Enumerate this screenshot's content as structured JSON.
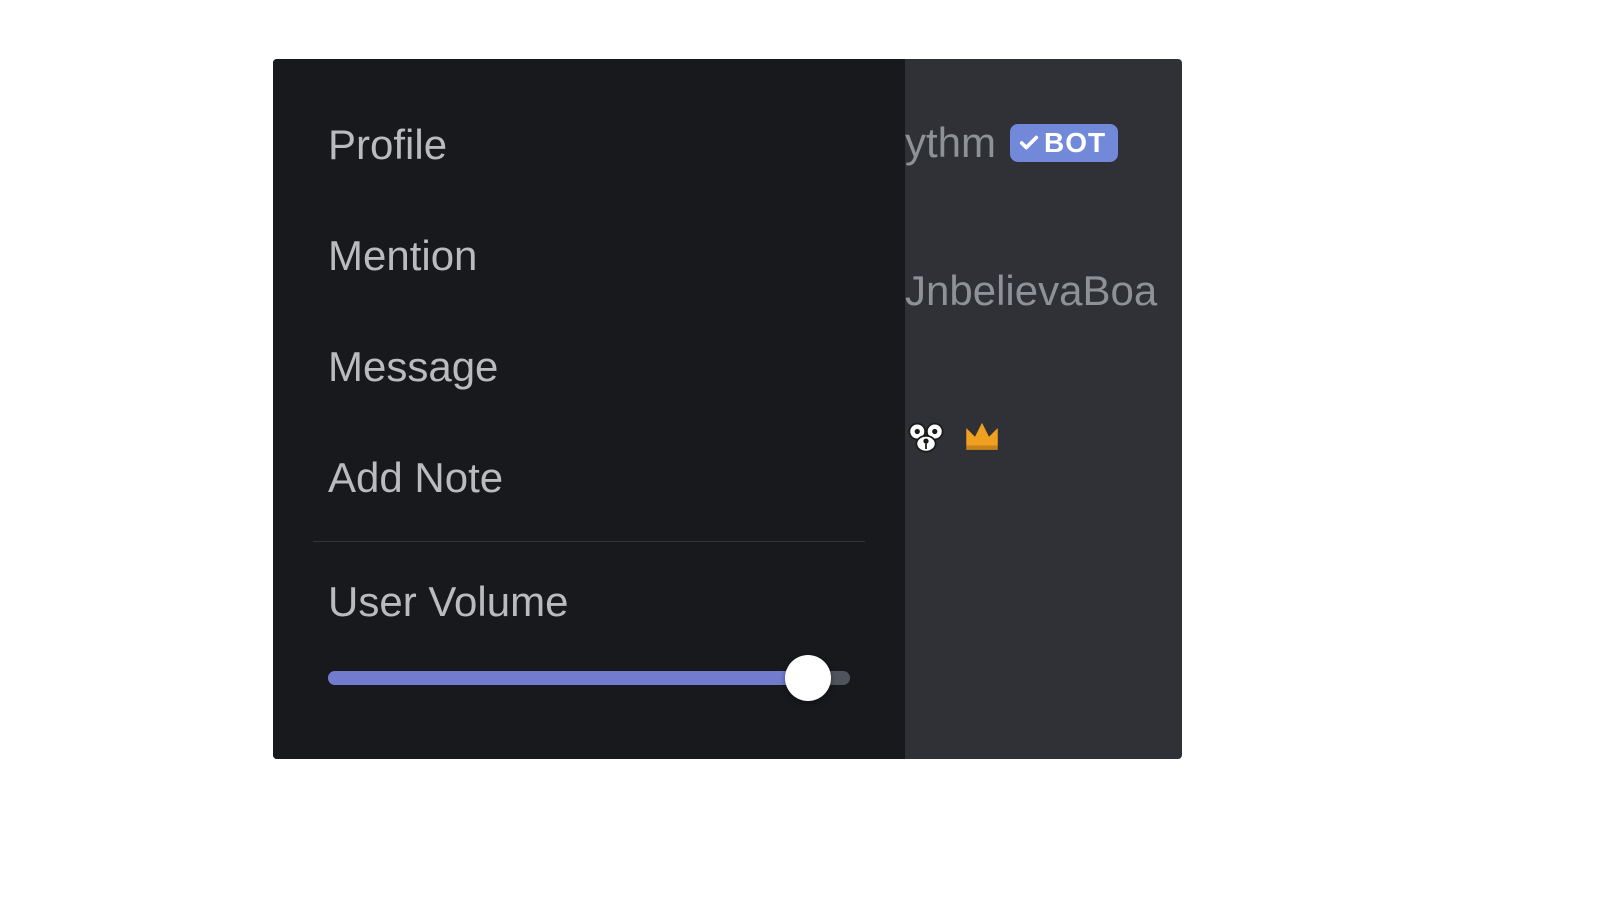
{
  "context_menu": {
    "items": [
      {
        "label": "Profile"
      },
      {
        "label": "Mention"
      },
      {
        "label": "Message"
      },
      {
        "label": "Add Note"
      }
    ],
    "volume": {
      "label": "User Volume",
      "percent": 92
    }
  },
  "members": {
    "row1": {
      "name_fragment": "ythm",
      "bot_badge_text": "BOT"
    },
    "row2": {
      "name_fragment": "JnbelievaBoa"
    },
    "row3": {
      "icons": [
        "dog-icon",
        "crown-icon"
      ]
    }
  },
  "colors": {
    "accent": "#7289da",
    "menu_bg": "#18191c",
    "panel_bg": "#2f3136",
    "text_muted": "#b9bbbe",
    "slider_fill": "#727ccf"
  }
}
